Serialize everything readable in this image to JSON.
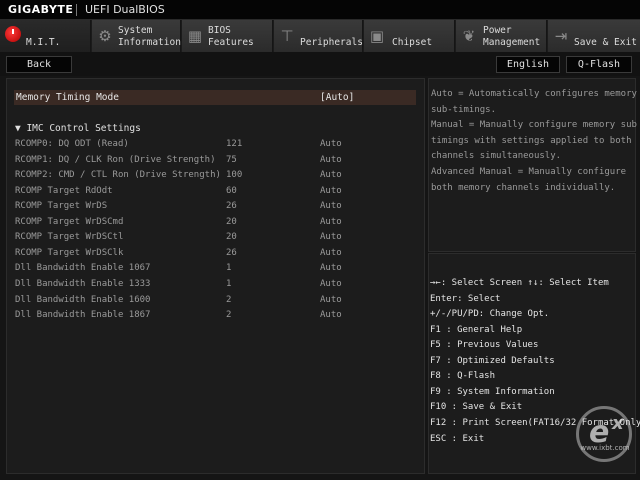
{
  "titlebar": {
    "brand": "GIGABYTE",
    "bios_name": "UEFI DualBIOS"
  },
  "tabs": [
    {
      "line1": "",
      "line2": "M.I.T.",
      "icon": "power-icon"
    },
    {
      "line1": "System",
      "line2": "Information",
      "icon": "gear-icon"
    },
    {
      "line1": "BIOS",
      "line2": "Features",
      "icon": "bios-chip-icon"
    },
    {
      "line1": "",
      "line2": "Peripherals",
      "icon": "plug-icon"
    },
    {
      "line1": "",
      "line2": "Chipset",
      "icon": "chipset-icon"
    },
    {
      "line1": "Power",
      "line2": "Management",
      "icon": "power-leaf-icon"
    },
    {
      "line1": "",
      "line2": "Save & Exit",
      "icon": "exit-icon"
    }
  ],
  "subbar": {
    "back": "Back",
    "language": "English",
    "qflash": "Q-Flash"
  },
  "main": {
    "selected": {
      "label": "Memory Timing Mode",
      "value": "[Auto]"
    },
    "section": "▼ IMC Control Settings",
    "rows": [
      {
        "label": "RCOMP0: DQ ODT (Read)",
        "current": "121",
        "setting": "Auto"
      },
      {
        "label": "RCOMP1: DQ / CLK Ron (Drive Strength)",
        "current": "75",
        "setting": "Auto"
      },
      {
        "label": "RCOMP2: CMD / CTL Ron (Drive Strength)",
        "current": "100",
        "setting": "Auto"
      },
      {
        "label": "RCOMP Target RdOdt",
        "current": "60",
        "setting": "Auto"
      },
      {
        "label": "RCOMP Target WrDS",
        "current": "26",
        "setting": "Auto"
      },
      {
        "label": "RCOMP Target WrDSCmd",
        "current": "20",
        "setting": "Auto"
      },
      {
        "label": "RCOMP Target WrDSCtl",
        "current": "20",
        "setting": "Auto"
      },
      {
        "label": "RCOMP Target WrDSClk",
        "current": "26",
        "setting": "Auto"
      },
      {
        "label": "Dll Bandwidth Enable 1067",
        "current": "1",
        "setting": "Auto"
      },
      {
        "label": "Dll Bandwidth Enable 1333",
        "current": "1",
        "setting": "Auto"
      },
      {
        "label": "Dll Bandwidth Enable 1600",
        "current": "2",
        "setting": "Auto"
      },
      {
        "label": "Dll Bandwidth Enable 1867",
        "current": "2",
        "setting": "Auto"
      }
    ]
  },
  "help": [
    "Auto = Automatically configures memory",
    "sub-timings.",
    "Manual = Manually configure memory sub",
    "timings with settings applied to both",
    "channels simultaneously.",
    "Advanced Manual = Manually configure",
    "both memory channels individually."
  ],
  "keys": [
    "→←: Select Screen  ↑↓: Select Item",
    "Enter: Select",
    "+/-/PU/PD: Change Opt.",
    "F1  : General Help",
    "F5  : Previous Values",
    "F7  : Optimized Defaults",
    "F8  : Q-Flash",
    "F9  : System Information",
    "F10 : Save & Exit",
    "F12 : Print Screen(FAT16/32 Format Only)",
    "ESC : Exit"
  ],
  "watermark": {
    "mark": "e",
    "sup": "x",
    "text": "www.ixbt.com"
  },
  "colors": {
    "accent": "#c00000",
    "selected_row": "#3a2a24",
    "panel": "#1c1c1c"
  }
}
